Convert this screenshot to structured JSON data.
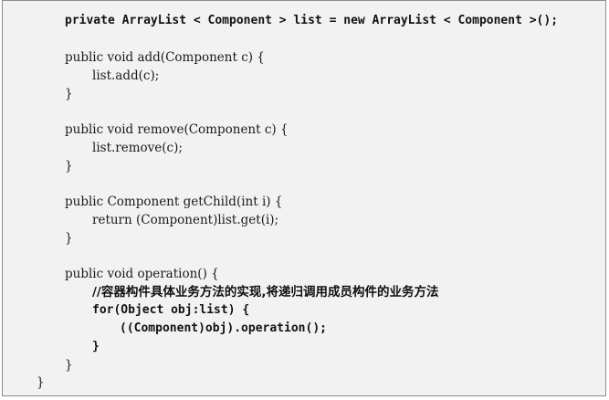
{
  "code": {
    "field_decl": "private ArrayList < Component > list = new ArrayList < Component >();",
    "add_sig": "public void add(Component c) {",
    "add_body": "list.add(c);",
    "add_close": "}",
    "remove_sig": "public void remove(Component c) {",
    "remove_body": "list.remove(c);",
    "remove_close": "}",
    "getchild_sig": "public Component getChild(int i) {",
    "getchild_body": "return (Component)list.get(i);",
    "getchild_close": "}",
    "operation_sig": "public void operation() {",
    "operation_comment": "//容器构件具体业务方法的实现,将递归调用成员构件的业务方法",
    "for_header": "for(Object obj:list) {",
    "for_body": "((Component)obj).operation();",
    "for_close": "}",
    "operation_close": "}",
    "class_close": "}"
  }
}
